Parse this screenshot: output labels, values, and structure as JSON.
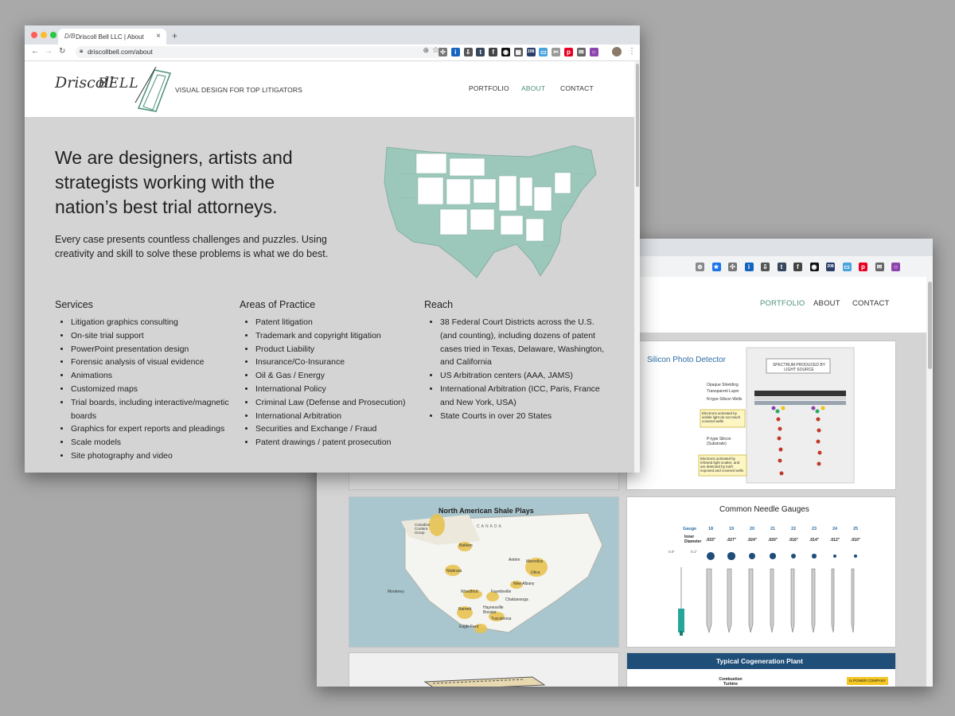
{
  "back_window": {
    "extensions": [
      {
        "icon": "magnifier-icon",
        "color": "#888888",
        "glyph": "⊕"
      },
      {
        "icon": "star-icon",
        "color": "#1a73e8",
        "glyph": "★"
      },
      {
        "icon": "compass-icon",
        "color": "#777777",
        "glyph": "✣"
      },
      {
        "icon": "info-icon",
        "color": "#1565c0",
        "glyph": "i"
      },
      {
        "icon": "download-icon",
        "color": "#555555",
        "glyph": "⇩"
      },
      {
        "icon": "tumblr-icon",
        "color": "#36465d",
        "glyph": "t"
      },
      {
        "icon": "formula-icon",
        "color": "#444444",
        "glyph": "f"
      },
      {
        "icon": "eye-icon",
        "color": "#111111",
        "glyph": "◉"
      },
      {
        "icon": "badge-icon",
        "color": "#2c3e6a",
        "glyph": "208"
      },
      {
        "icon": "window-icon",
        "color": "#4aa3df",
        "glyph": "▭"
      },
      {
        "icon": "pinterest-icon",
        "color": "#e60023",
        "glyph": "p"
      },
      {
        "icon": "message-icon",
        "color": "#666666",
        "glyph": "✉"
      },
      {
        "icon": "ring-icon",
        "color": "#8e44ad",
        "glyph": "○"
      }
    ],
    "nav": {
      "portfolio": "PORTFOLIO",
      "about": "ABOUT",
      "contact": "CONTACT"
    },
    "tiles": {
      "silicon": {
        "title": "Silicon Photo Detector",
        "spectrum": "SPECTRUM PRODUCED BY LIGHT SOURCE",
        "labels": [
          "Opaque Shielding",
          "Transparent Layer",
          "N-type Silicon Wells",
          "Electrons activated by visible light do not reach covered wells",
          "P-type Silicon (Substrate)",
          "Electrons activated by infrared light scatter, and are detected by both exposed and covered wells"
        ]
      },
      "shale": {
        "title": "North American Shale Plays",
        "canada": "CANADA",
        "places": [
          "Canadian Cordera Group",
          "Bakken",
          "Niobrara",
          "Antrim",
          "Marcellus",
          "Utica",
          "Monterey",
          "New Albany",
          "Woodford",
          "Fayetteville",
          "Barnett",
          "Chattanooga",
          "Haynesville Bossier",
          "Tuscaloosa",
          "Eagle Ford"
        ]
      },
      "needle": {
        "title": "Common Needle Gauges",
        "gauge_label": "Gauge",
        "gauges": [
          "18",
          "19",
          "20",
          "21",
          "22",
          "23",
          "24",
          "25"
        ],
        "diameter_label": "Inner Diameter",
        "diameters": [
          ".033\"",
          ".027\"",
          ".024\"",
          ".020\"",
          ".016\"",
          ".014\"",
          ".012\"",
          ".010\""
        ],
        "scale": [
          "0.0\"",
          "0.1\""
        ]
      },
      "cogen": {
        "title": "Typical Cogeneration Plant",
        "combustion": "Combustion Turbine",
        "power_company": "to POWER COMPANY"
      }
    }
  },
  "front_window": {
    "tab_title": "Driscoll Bell LLC | About",
    "favicon": "D/B",
    "tab_close": "×",
    "new_tab": "+",
    "url": "driscollbell.com/about",
    "extensions": [
      {
        "icon": "compass-icon",
        "color": "#777777",
        "glyph": "✣"
      },
      {
        "icon": "info-icon",
        "color": "#1565c0",
        "glyph": "i"
      },
      {
        "icon": "download-icon",
        "color": "#555555",
        "glyph": "⇩"
      },
      {
        "icon": "tumblr-icon",
        "color": "#36465d",
        "glyph": "t"
      },
      {
        "icon": "formula-icon",
        "color": "#444444",
        "glyph": "f"
      },
      {
        "icon": "eye-icon",
        "color": "#111111",
        "glyph": "◉"
      },
      {
        "icon": "grid-icon",
        "color": "#555555",
        "glyph": "▦"
      },
      {
        "icon": "badge-icon",
        "color": "#2c3e6a",
        "glyph": "208"
      },
      {
        "icon": "window-icon",
        "color": "#4aa3df",
        "glyph": "▭"
      },
      {
        "icon": "clip-icon",
        "color": "#999999",
        "glyph": "✂"
      },
      {
        "icon": "pinterest-icon",
        "color": "#e60023",
        "glyph": "p"
      },
      {
        "icon": "message-icon",
        "color": "#666666",
        "glyph": "✉"
      },
      {
        "icon": "ring-icon",
        "color": "#8e44ad",
        "glyph": "○"
      }
    ],
    "logo": {
      "driscoll": "Driscoll",
      "bell": "BELL"
    },
    "tagline": "VISUAL DESIGN FOR TOP LITIGATORS",
    "nav": {
      "portfolio": "PORTFOLIO",
      "about": "ABOUT",
      "contact": "CONTACT",
      "active_color": "#4b8f7a"
    },
    "headline": "We are designers, artists and strategists working with the nation’s best trial attorneys.",
    "intro": "Every case presents countless challenges and puzzles. Using creativity and skill to solve these problems is what we do best.",
    "map_colors": {
      "teal": "#9cc7bb",
      "white": "#ffffff"
    },
    "columns": [
      {
        "heading": "Services",
        "items": [
          "Litigation graphics consulting",
          "On-site trial support",
          "PowerPoint presentation design",
          "Forensic analysis of visual evidence",
          "Animations",
          "Customized maps",
          "Trial boards, including interactive/magnetic boards",
          "Graphics for expert reports and pleadings",
          "Scale models",
          "Site photography and video"
        ]
      },
      {
        "heading": "Areas of Practice",
        "items": [
          "Patent litigation",
          "Trademark and copyright litigation",
          "Product Liability",
          "Insurance/Co-Insurance",
          "Oil & Gas / Energy",
          "International Policy",
          "Criminal Law (Defense and Prosecution)",
          "International Arbitration",
          "Securities and Exchange / Fraud",
          "Patent drawings / patent prosecution"
        ]
      },
      {
        "heading": "Reach",
        "items": [
          "38 Federal Court Districts across the U.S. (and counting), including dozens of patent cases tried in Texas, Delaware, Washington, and California",
          "US Arbitration centers (AAA, JAMS)",
          "International Arbitration (ICC, Paris, France and New York, USA)",
          "State Courts in over 20 States"
        ]
      }
    ]
  }
}
